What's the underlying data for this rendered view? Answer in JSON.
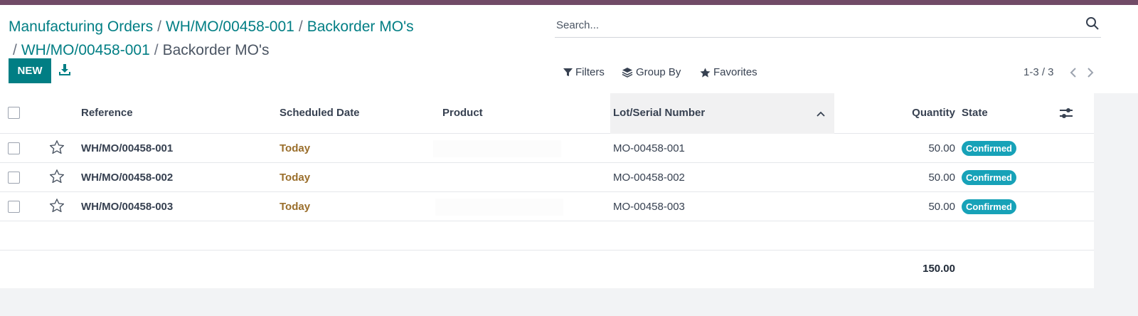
{
  "breadcrumb": {
    "items": [
      "Manufacturing Orders",
      "WH/MO/00458-001",
      "Backorder MO's",
      "WH/MO/00458-001"
    ],
    "current": "Backorder MO's",
    "separator": "/"
  },
  "actions": {
    "new_label": "NEW",
    "download_icon": "download-icon"
  },
  "search": {
    "placeholder": "Search...",
    "value": "",
    "icon": "search-icon"
  },
  "toolbar": {
    "filters_label": "Filters",
    "group_by_label": "Group By",
    "favorites_label": "Favorites"
  },
  "pager": {
    "text": "1-3 / 3"
  },
  "table": {
    "columns": {
      "reference": "Reference",
      "scheduled_date": "Scheduled Date",
      "product": "Product",
      "lot": "Lot/Serial Number",
      "quantity": "Quantity",
      "state": "State"
    },
    "sorted_column": "Lot/Serial Number",
    "rows": [
      {
        "reference": "WH/MO/00458-001",
        "scheduled_date": "Today",
        "product": "",
        "lot": "MO-00458-001",
        "quantity": "50.00",
        "state": "Confirmed"
      },
      {
        "reference": "WH/MO/00458-002",
        "scheduled_date": "Today",
        "product": "",
        "lot": "MO-00458-002",
        "quantity": "50.00",
        "state": "Confirmed"
      },
      {
        "reference": "WH/MO/00458-003",
        "scheduled_date": "Today",
        "product": "",
        "lot": "MO-00458-003",
        "quantity": "50.00",
        "state": "Confirmed"
      }
    ],
    "total_quantity": "150.00"
  },
  "colors": {
    "brand_bar": "#714b67",
    "primary": "#017e84",
    "badge": "#17a2b8",
    "date": "#9a6e2b"
  }
}
